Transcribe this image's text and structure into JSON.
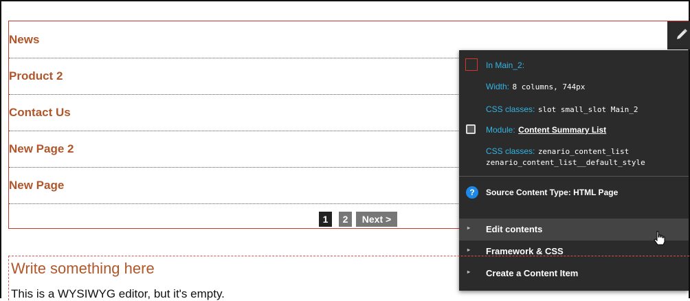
{
  "content_list": {
    "items": [
      {
        "label": "News"
      },
      {
        "label": "Product 2"
      },
      {
        "label": "Contact Us"
      },
      {
        "label": "New Page 2"
      },
      {
        "label": "New Page"
      }
    ]
  },
  "pagination": {
    "page1": "1",
    "page2": "2",
    "next": "Next >"
  },
  "popup": {
    "slot_label": "In Main_2:",
    "width_label": "Width:",
    "width_value": "8 columns, 744px",
    "css_label": "CSS classes:",
    "css_value": "slot small_slot Main_2",
    "module_label": "Module:",
    "module_name": "Content Summary List",
    "module_css_label": "CSS classes:",
    "module_css_value_1": "zenario_content_list",
    "module_css_value_2": "zenario_content_list__default_style",
    "source_label": "Source Content Type: HTML Page",
    "menu": [
      {
        "label": "Edit contents"
      },
      {
        "label": "Framework & CSS"
      },
      {
        "label": "Create a Content Item"
      }
    ]
  },
  "wysiwyg": {
    "title": "Write something here",
    "body": "This is a WYSIWYG editor, but it's empty."
  },
  "colors": {
    "link_brown": "#b0562b",
    "slot_red": "#c0392b",
    "popup_bg": "#2b2b2b",
    "accent_cyan": "#33b5e5"
  }
}
